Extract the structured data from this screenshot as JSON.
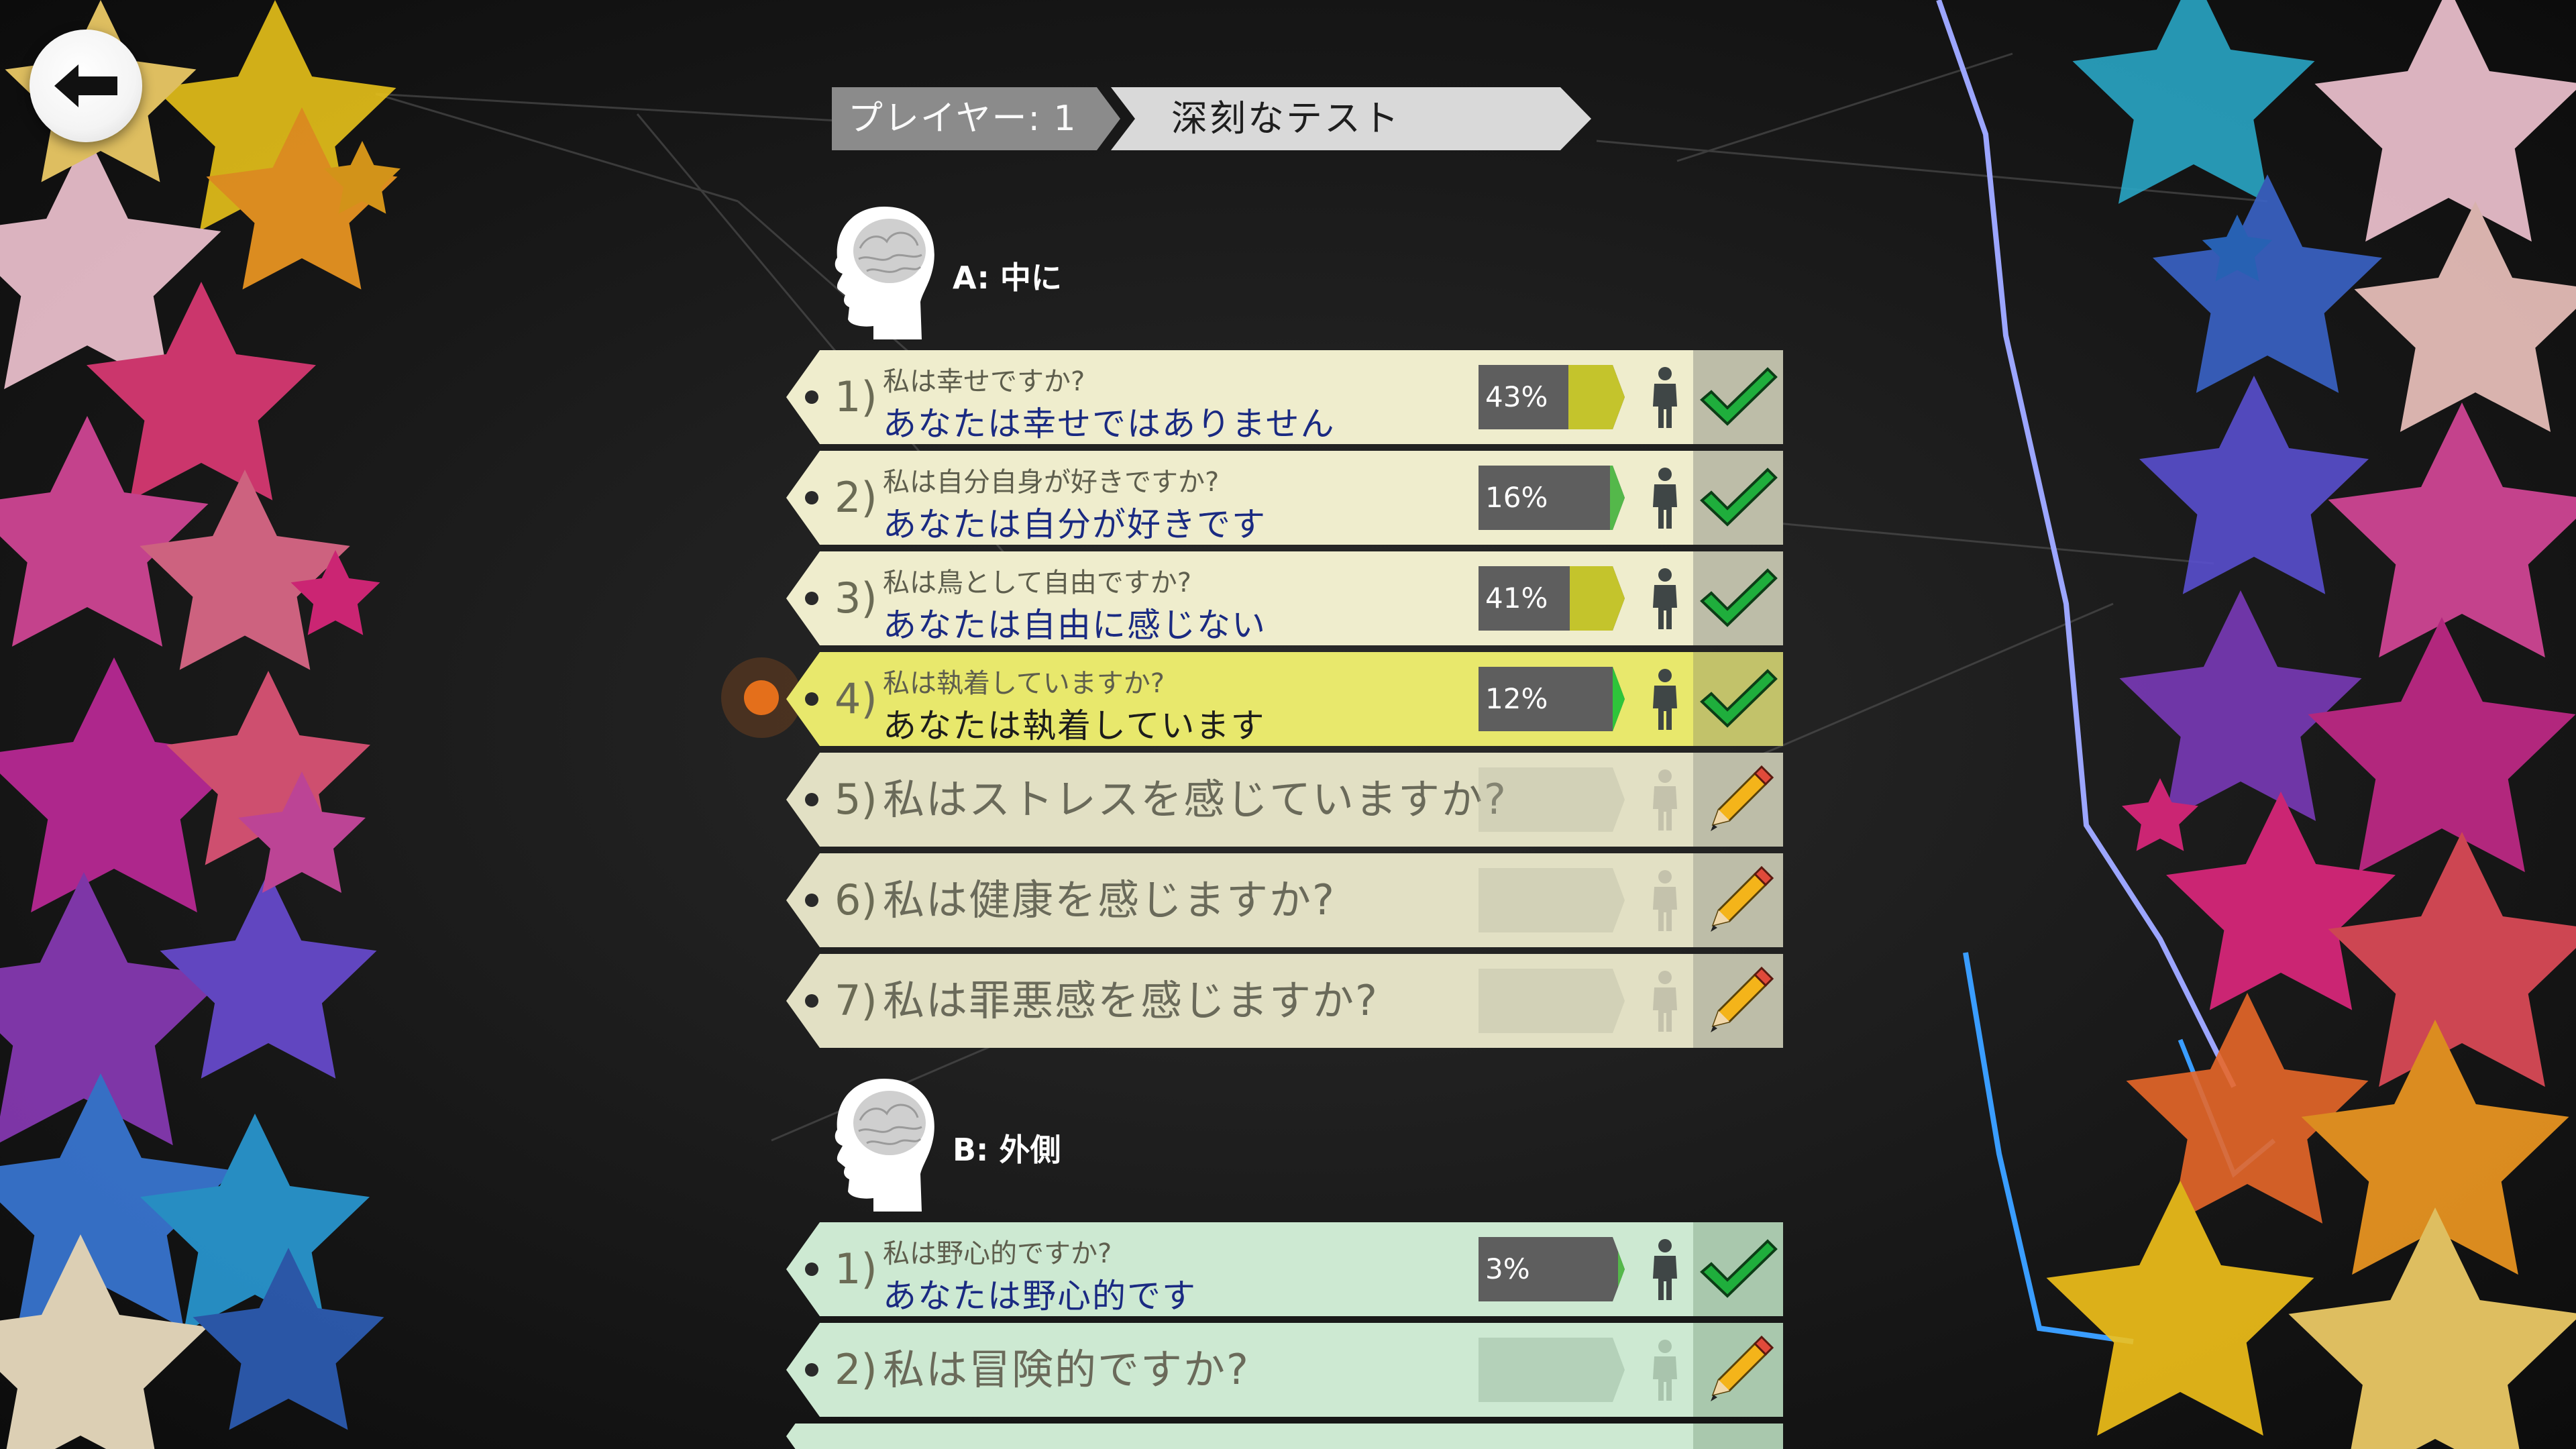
{
  "header": {
    "player_label": "プレイヤー: 1",
    "test_title": "深刻なテスト"
  },
  "colors": {
    "row_done": "#efedcd",
    "row_active": "#e8e86c",
    "row_pending": "#e2e0c4",
    "row_b": "#cde9d2",
    "status_done": "#bdbda8",
    "status_b": "#a9c8ad",
    "answer_text": "#1a2a82",
    "meter_fill_a": "#c4c42c",
    "meter_fill_b": "#54b84a"
  },
  "sections": [
    {
      "label": "A: 中に",
      "icon": "head-brain-icon",
      "questions": [
        {
          "num": "1)",
          "question": "私は幸せですか?",
          "answer": "あなたは幸せではありません",
          "percent": "43%",
          "value": 43,
          "status": "done"
        },
        {
          "num": "2)",
          "question": "私は自分自身が好きですか?",
          "answer": "あなたは自分が好きです",
          "percent": "16%",
          "value": 16,
          "status": "done"
        },
        {
          "num": "3)",
          "question": "私は鳥として自由ですか?",
          "answer": "あなたは自由に感じない",
          "percent": "41%",
          "value": 41,
          "status": "done"
        },
        {
          "num": "4)",
          "question": "私は執着していますか?",
          "answer": "あなたは執着しています",
          "percent": "12%",
          "value": 12,
          "status": "active"
        },
        {
          "num": "5)",
          "question": "私はストレスを感じていますか?",
          "status": "pending"
        },
        {
          "num": "6)",
          "question": "私は健康を感じますか?",
          "status": "pending"
        },
        {
          "num": "7)",
          "question": "私は罪悪感を感じますか?",
          "status": "pending"
        }
      ]
    },
    {
      "label": "B: 外側",
      "icon": "head-brain-icon",
      "questions": [
        {
          "num": "1)",
          "question": "私は野心的ですか?",
          "answer": "あなたは野心的です",
          "percent": "3%",
          "value": 3,
          "status": "done"
        },
        {
          "num": "2)",
          "question": "私は冒険的ですか?",
          "status": "pending"
        }
      ]
    }
  ]
}
